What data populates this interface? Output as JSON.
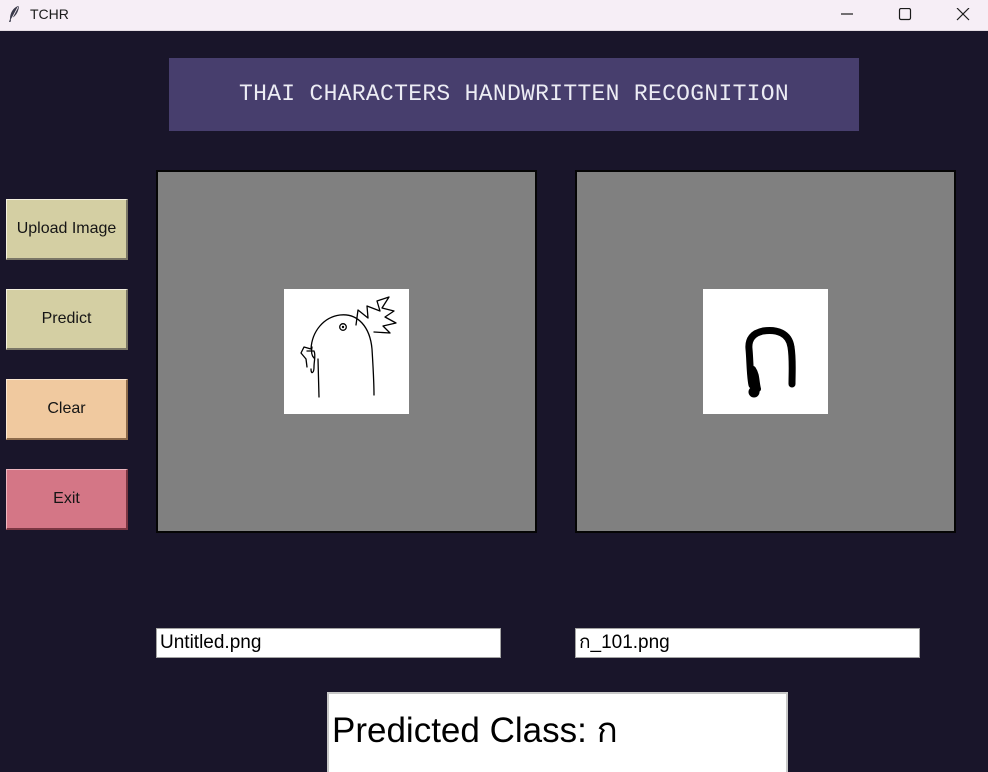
{
  "window": {
    "title": "TCHR",
    "app_icon": "feather-icon",
    "controls": [
      "minimize-icon",
      "maximize-icon",
      "close-icon"
    ]
  },
  "header": {
    "title": "THAI CHARACTERS HANDWRITTEN RECOGNITION"
  },
  "sidebar": {
    "upload_label": "Upload Image",
    "predict_label": "Predict",
    "clear_label": "Clear",
    "exit_label": "Exit"
  },
  "panels": {
    "input_image": "hand-drawn-rooster-sketch",
    "predicted_image": "thai-character-ko-kai"
  },
  "files": {
    "input_filename": "Untitled.png",
    "predicted_filename": "ก_101.png"
  },
  "result": {
    "label": "Predicted Class: ",
    "value": "ก"
  },
  "colors": {
    "background": "#19152a",
    "header_bg": "#473e6d",
    "upload_bg": "#d4cfa3",
    "predict_bg": "#d4cfa3",
    "clear_bg": "#f0c99f",
    "exit_bg": "#d47686",
    "panel_bg": "#808080"
  }
}
